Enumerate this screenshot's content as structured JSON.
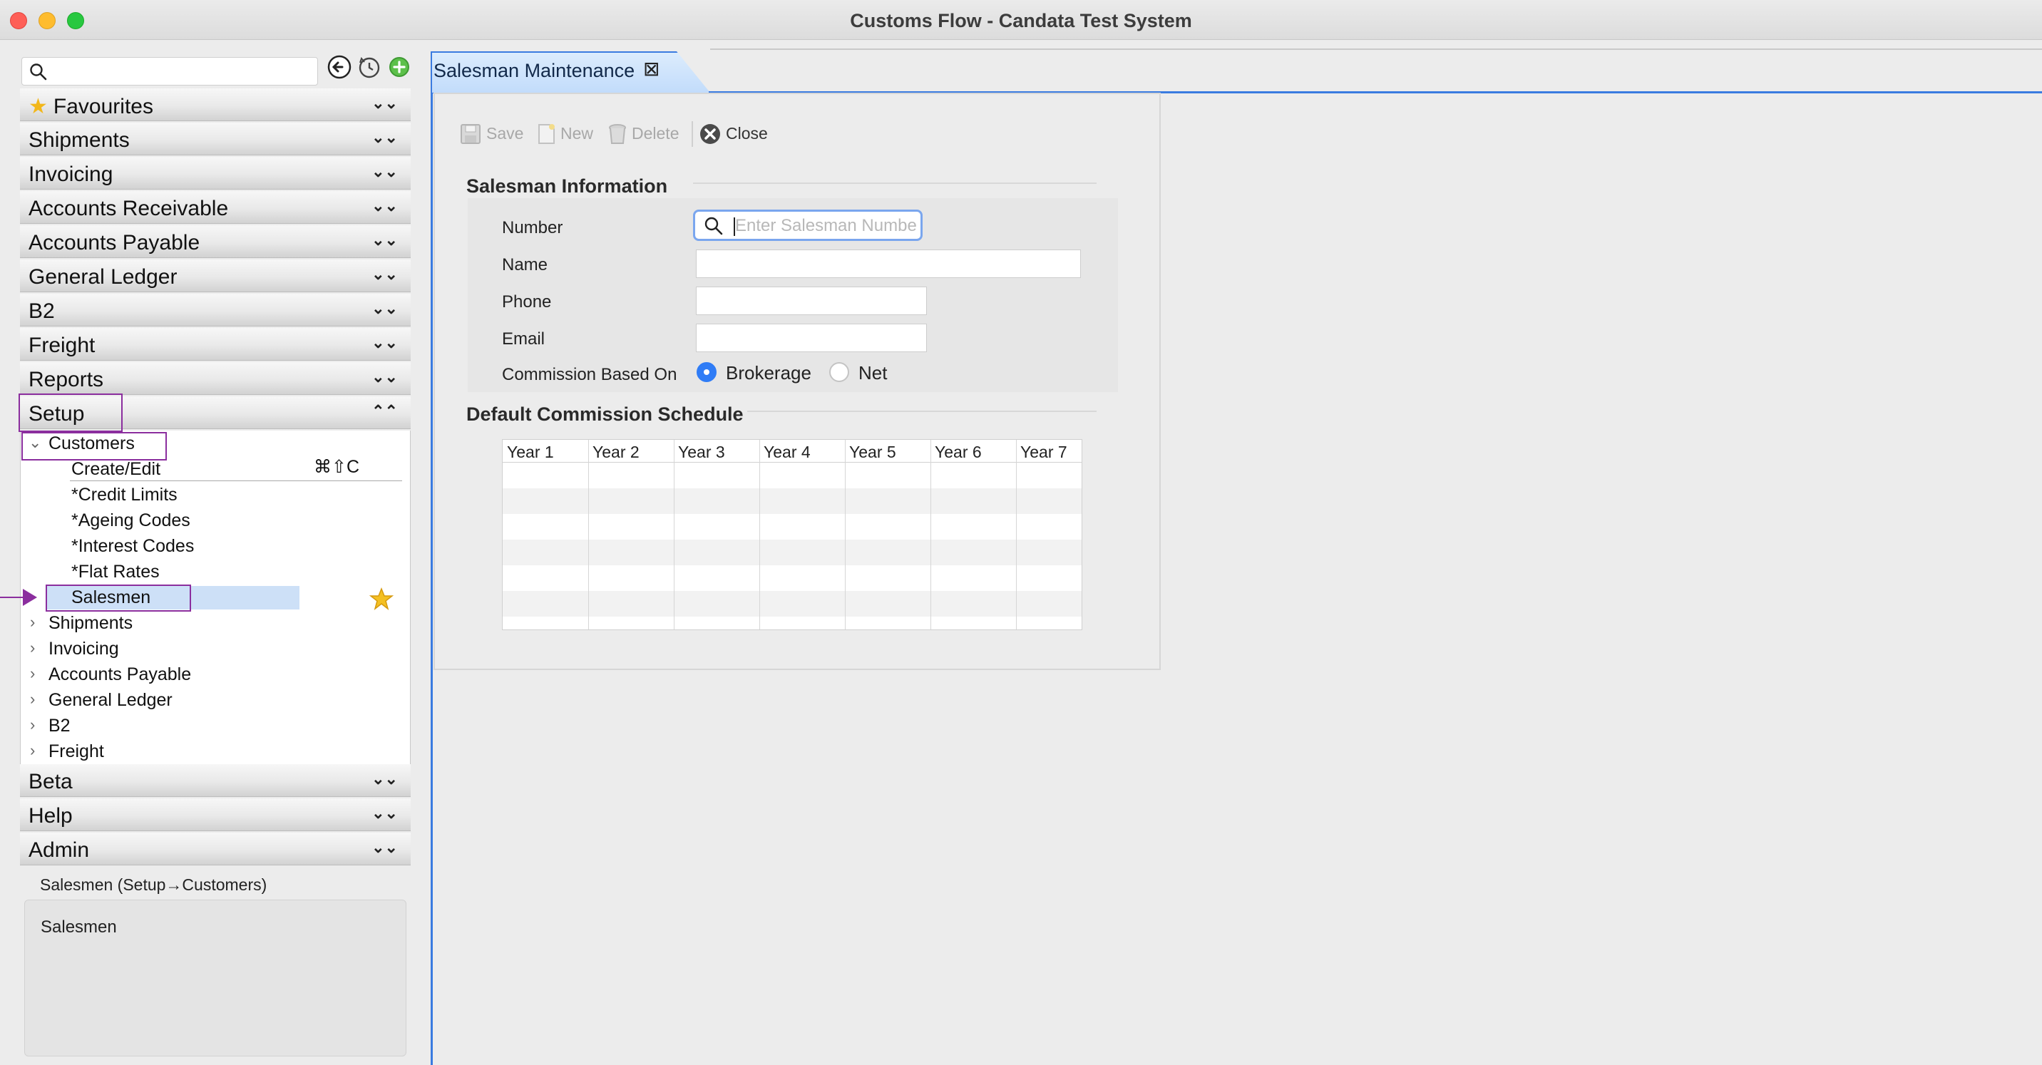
{
  "window": {
    "title": "Customs Flow - Candata Test System"
  },
  "sidebar": {
    "search_placeholder": "",
    "accordion": [
      {
        "label": "Favourites",
        "icon": "star-icon"
      },
      {
        "label": "Shipments"
      },
      {
        "label": "Invoicing"
      },
      {
        "label": "Accounts Receivable"
      },
      {
        "label": "Accounts Payable"
      },
      {
        "label": "General Ledger"
      },
      {
        "label": "B2"
      },
      {
        "label": "Freight"
      },
      {
        "label": "Reports"
      },
      {
        "label": "Setup",
        "expanded": true
      },
      {
        "label": "Beta"
      },
      {
        "label": "Help"
      },
      {
        "label": "Admin"
      }
    ],
    "setup_tree": {
      "customers": {
        "label": "Customers",
        "children": [
          {
            "label": "Create/Edit",
            "shortcut": "⌘⇧C"
          },
          {
            "label": "*Credit Limits"
          },
          {
            "label": "*Ageing Codes"
          },
          {
            "label": "*Interest Codes"
          },
          {
            "label": "*Flat Rates"
          },
          {
            "label": "Salesmen",
            "selected": true,
            "favourite": true
          }
        ]
      },
      "collapsed": [
        {
          "label": "Shipments"
        },
        {
          "label": "Invoicing"
        },
        {
          "label": "Accounts Payable"
        },
        {
          "label": "General Ledger"
        },
        {
          "label": "B2"
        },
        {
          "label": "Freight"
        }
      ]
    },
    "status_path": "Salesmen (Setup→Customers)",
    "description": "Salesmen"
  },
  "tabs": [
    {
      "label": "Salesman Maintenance",
      "active": true
    }
  ],
  "toolbar": {
    "save": "Save",
    "new": "New",
    "delete": "Delete",
    "close": "Close"
  },
  "form": {
    "section_info": "Salesman Information",
    "number_label": "Number",
    "number_placeholder": "Enter Salesman Number",
    "number_value": "",
    "name_label": "Name",
    "name_value": "",
    "phone_label": "Phone",
    "phone_value": "",
    "email_label": "Email",
    "email_value": "",
    "commission_label": "Commission Based On",
    "commission_options": [
      "Brokerage",
      "Net"
    ],
    "commission_selected": "Brokerage"
  },
  "schedule": {
    "title": "Default Commission Schedule",
    "columns": [
      "Year 1",
      "Year 2",
      "Year 3",
      "Year 4",
      "Year 5",
      "Year 6",
      "Year 7"
    ],
    "rows": [
      [],
      [],
      [],
      [],
      [],
      [],
      []
    ]
  },
  "colors": {
    "accent": "#3a7be0",
    "selection": "#cde0f7",
    "annotation": "#8b2e9e",
    "radio_on": "#2f7cf6"
  }
}
